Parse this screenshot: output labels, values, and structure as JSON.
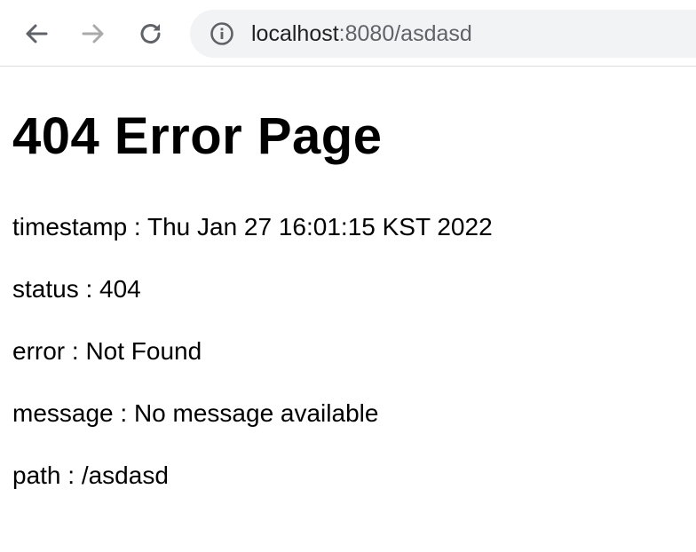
{
  "browser": {
    "back_icon": "arrow-left-icon",
    "forward_icon": "arrow-right-icon",
    "reload_icon": "reload-icon",
    "site_info_icon": "info-circle-icon",
    "url_host": "localhost",
    "url_rest": ":8080/asdasd",
    "colors": {
      "toolbar_bg": "#ffffff",
      "omnibox_bg": "#f1f3f4",
      "icon_active": "#5f6368",
      "icon_disabled": "#aaaaaa"
    }
  },
  "page": {
    "title": "404 Error Page",
    "lines": [
      "timestamp : Thu Jan 27 16:01:15 KST 2022",
      "status : 404",
      "error : Not Found",
      "message : No message available",
      "path : /asdasd"
    ]
  }
}
